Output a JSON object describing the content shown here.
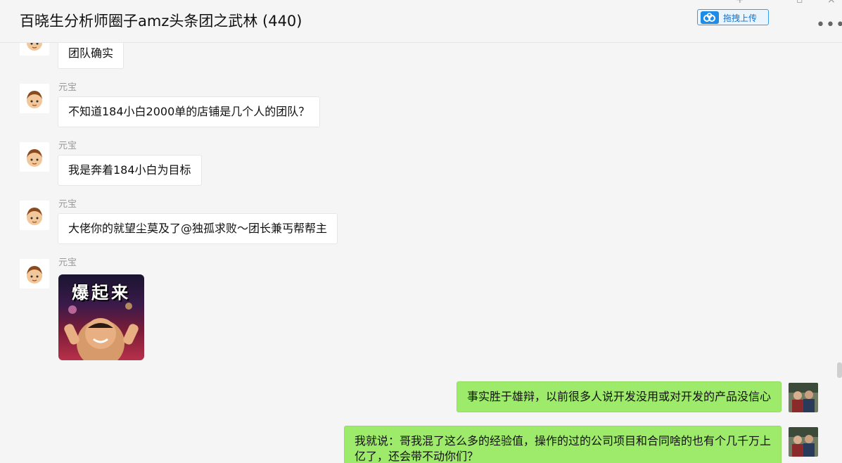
{
  "window": {
    "title": "百晓生分析师圈子amz头条团之武林 (440)",
    "upload_label": "拖拽上传",
    "more_label": "•••"
  },
  "messages": [
    {
      "sender": "",
      "text": "团队确实",
      "mine": false
    },
    {
      "sender": "元宝",
      "text": "不知道184小白2000单的店铺是几个人的团队？",
      "mine": false
    },
    {
      "sender": "元宝",
      "text": "我是奔着184小白为目标",
      "mine": false
    },
    {
      "sender": "元宝",
      "text": "大佬你的就望尘莫及了@独孤求败～团长兼丐帮帮主",
      "mine": false
    },
    {
      "sender": "元宝",
      "sticker_text": "爆起来",
      "mine": false
    },
    {
      "sender": "",
      "text": "事实胜于雄辩，以前很多人说开发没用或对开发的产品没信心",
      "mine": true
    },
    {
      "sender": "",
      "text": "我就说：哥我混了这么多的经验值，操作的过的公司项目和合同啥的也有个几千万上亿了，还会带不动你们？",
      "mine": true
    }
  ],
  "colors": {
    "bubble_mine": "#9eea6a",
    "bubble_other": "#ffffff",
    "background": "#f5f5f5"
  }
}
